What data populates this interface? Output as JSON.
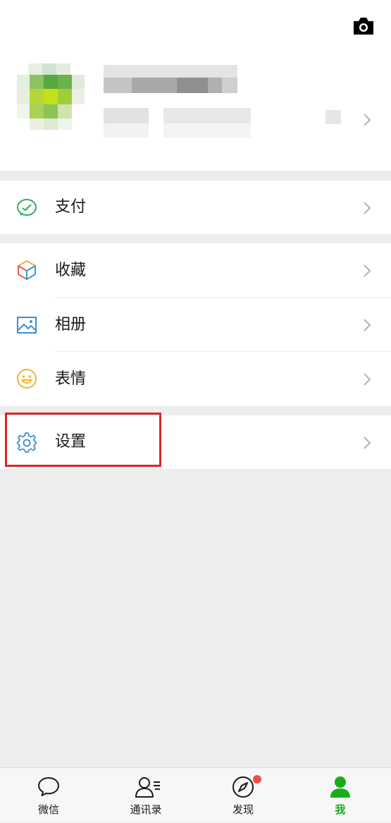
{
  "menu": {
    "pay": {
      "label": "支付",
      "icon": "wechat-pay-icon"
    },
    "favorites": {
      "label": "收藏",
      "icon": "favorites-cube-icon"
    },
    "album": {
      "label": "相册",
      "icon": "album-photo-icon"
    },
    "stickers": {
      "label": "表情",
      "icon": "sticker-smile-icon"
    },
    "settings": {
      "label": "设置",
      "icon": "gear-icon"
    }
  },
  "tabbar": {
    "tabs": [
      {
        "label": "微信",
        "icon": "chat-bubble-icon"
      },
      {
        "label": "通讯录",
        "icon": "contacts-icon"
      },
      {
        "label": "发现",
        "icon": "compass-icon",
        "badge": true
      },
      {
        "label": "我",
        "icon": "person-icon",
        "active": true
      }
    ]
  },
  "colors": {
    "accent": "#1aad19",
    "highlight": "#d9262b",
    "badge": "#f04c4c"
  }
}
